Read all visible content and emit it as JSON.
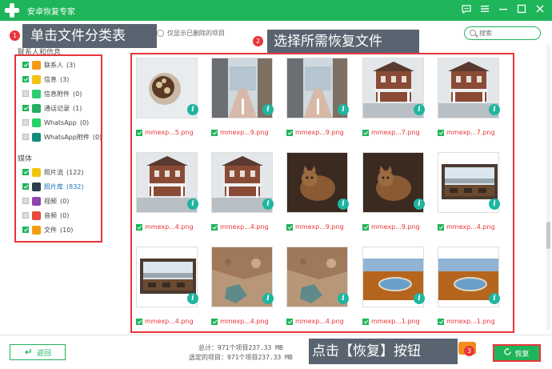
{
  "app": {
    "title": "安卓恢复专家"
  },
  "toolbar": {
    "show_deleted_label": "仅显示已删除的项目",
    "search_placeholder": "搜索"
  },
  "sidebar": {
    "group1": "联系人和信息",
    "items": [
      {
        "label": "联系人",
        "count": "(3)",
        "color": "#f39c12",
        "checked": "on"
      },
      {
        "label": "信息",
        "count": "(3)",
        "color": "#f1c40f",
        "checked": "on"
      },
      {
        "label": "信息附件",
        "count": "(0)",
        "color": "#2ecc71",
        "checked": "grey"
      },
      {
        "label": "通话记录",
        "count": "(1)",
        "color": "#27ae60",
        "checked": "on"
      },
      {
        "label": "WhatsApp",
        "count": "(0)",
        "color": "#25d366",
        "checked": "grey"
      },
      {
        "label": "WhatsApp附件",
        "count": "(0)",
        "color": "#128c7e",
        "checked": "grey"
      }
    ],
    "group2": "媒体",
    "media": [
      {
        "label": "照片流",
        "count": "(122)",
        "color": "#f1c40f",
        "checked": "on"
      },
      {
        "label": "照片库",
        "count": "(832)",
        "color": "#2c3e50",
        "checked": "on",
        "active": true
      },
      {
        "label": "视频",
        "count": "(0)",
        "color": "#8e44ad",
        "checked": "grey"
      },
      {
        "label": "音频",
        "count": "(0)",
        "color": "#e74c3c",
        "checked": "grey"
      },
      {
        "label": "文件",
        "count": "(10)",
        "color": "#f39c12",
        "checked": "on"
      }
    ]
  },
  "annotations": {
    "step1_num": "1",
    "step1_text": "单击文件分类表",
    "step2_num": "2",
    "step2_text": "选择所需恢复文件",
    "step3_num": "3",
    "step3_text": "点击【恢复】按钮"
  },
  "grid": {
    "files": [
      {
        "name": "mmexp...5.png",
        "kind": "food"
      },
      {
        "name": "mmexp...9.png",
        "kind": "street"
      },
      {
        "name": "mmexp...9.png",
        "kind": "street"
      },
      {
        "name": "mmexp...7.png",
        "kind": "house"
      },
      {
        "name": "mmexp...7.png",
        "kind": "house"
      },
      {
        "name": "mmexp...4.png",
        "kind": "house"
      },
      {
        "name": "mmexp...4.png",
        "kind": "house"
      },
      {
        "name": "mmexp...9.png",
        "kind": "cat"
      },
      {
        "name": "mmexp...9.png",
        "kind": "cat"
      },
      {
        "name": "mmexp...4.png",
        "kind": "window"
      },
      {
        "name": "mmexp...4.png",
        "kind": "window"
      },
      {
        "name": "mmexp...4.png",
        "kind": "rock"
      },
      {
        "name": "mmexp...4.png",
        "kind": "rock"
      },
      {
        "name": "mmexp...1.png",
        "kind": "lake"
      },
      {
        "name": "mmexp...1.png",
        "kind": "lake"
      }
    ]
  },
  "footer": {
    "back_label": "返回",
    "total_text": "总计：971个项目237.33 MB",
    "selected_text": "选定的项目：971个项目237.33 MB",
    "recover_label": "恢复"
  }
}
